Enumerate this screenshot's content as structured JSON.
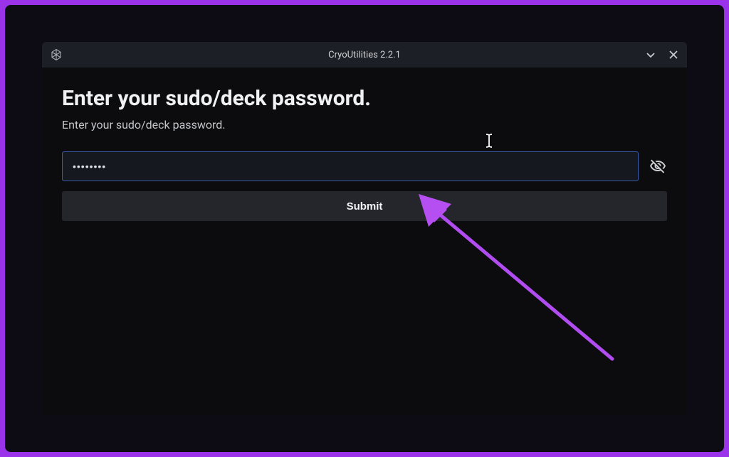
{
  "titlebar": {
    "title": "CryoUtilities 2.2.1"
  },
  "dialog": {
    "heading": "Enter your sudo/deck password.",
    "subheading": "Enter your sudo/deck password.",
    "password_value": "••••••••",
    "submit_label": "Submit"
  },
  "colors": {
    "border_accent": "#9b33ea",
    "input_focus": "#3a5ba8",
    "window_bg": "#0c0c0f",
    "titlebar_bg": "#1c1f25"
  }
}
